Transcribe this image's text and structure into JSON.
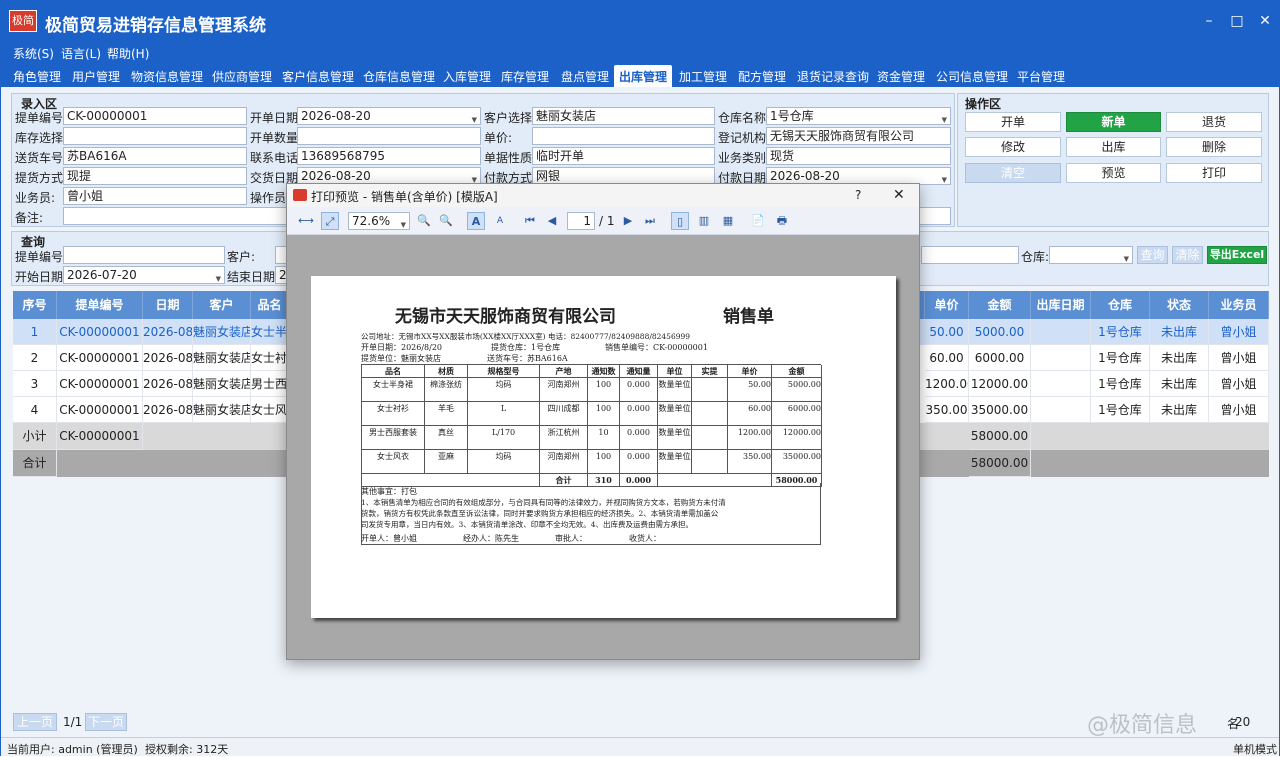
{
  "app": {
    "logo_text": "极简",
    "title": "极简贸易进销存信息管理系统",
    "window_controls": [
      "–",
      "□",
      "✕"
    ]
  },
  "menu": [
    "系统(S)",
    "语言(L)",
    "帮助(H)"
  ],
  "tabs": [
    "角色管理",
    "用户管理",
    "物资信息管理",
    "供应商管理",
    "客户信息管理",
    "仓库信息管理",
    "入库管理",
    "库存管理",
    "盘点管理",
    "出库管理",
    "加工管理",
    "配方管理",
    "退货记录查询",
    "资金管理",
    "公司信息管理",
    "平台管理"
  ],
  "active_tab": "出库管理",
  "entry": {
    "title": "录入区",
    "tihuo_no_label": "提单编号:",
    "tihuo_no": "CK-00000001",
    "open_date_label": "开单日期:",
    "open_date": "2026-08-20",
    "customer_label": "客户选择:",
    "customer": "魅丽女装店",
    "warehouse_label": "仓库名称:",
    "warehouse": "1号仓库",
    "stock_sel_label": "库存选择:",
    "stock_sel": "",
    "qty_label": "开单数量:",
    "qty": "",
    "price_label": "单价:",
    "price": "",
    "org_label": "登记机构:",
    "org": "无锡天天服饰商贸有限公司",
    "car_label": "送货车号:",
    "car": "苏BA616A",
    "phone_label": "联系电话:",
    "phone": "13689568795",
    "doc_nature_label": "单据性质:",
    "doc_nature": "临时开单",
    "biz_type_label": "业务类别:",
    "biz_type": "现货",
    "pickup_label": "提货方式:",
    "pickup": "现提",
    "deliver_date_label": "交货日期:",
    "deliver_date": "2026-08-20",
    "pay_method_label": "付款方式:",
    "pay_method": "网银",
    "pay_date_label": "付款日期:",
    "pay_date": "2026-08-20",
    "salesman_label": "业务员:",
    "salesman": "曾小姐",
    "operator_label": "操作员:",
    "remark_label": "备注:"
  },
  "ops": {
    "title": "操作区",
    "buttons": [
      "开单",
      "新单",
      "退货",
      "修改",
      "出库",
      "删除",
      "清空",
      "预览",
      "打印"
    ]
  },
  "query": {
    "title": "查询",
    "tihuo_no_label": "提单编号:",
    "customer_label": "客户:",
    "start_date_label": "开始日期:",
    "start_date": "2026-07-20",
    "end_date_label": "结束日期:",
    "end_date": "20",
    "warehouse_label": "仓库:",
    "search": "查询",
    "clear": "清除",
    "export": "导出Excel"
  },
  "grid": {
    "columns": [
      "序号",
      "提单编号",
      "日期",
      "客户",
      "品名",
      "单价",
      "金额",
      "出库日期",
      "仓库",
      "状态",
      "业务员"
    ],
    "rows": [
      {
        "no": "1",
        "id": "CK-00000001",
        "date": "2026-08-...",
        "cust": "魅丽女装店",
        "name": "女士半",
        "price": "50.00",
        "amount": "5000.00",
        "out": "",
        "wh": "1号仓库",
        "status": "未出库",
        "staff": "曾小姐"
      },
      {
        "no": "2",
        "id": "CK-00000001",
        "date": "2026-08-...",
        "cust": "魅丽女装店",
        "name": "女士衬",
        "price": "60.00",
        "amount": "6000.00",
        "out": "",
        "wh": "1号仓库",
        "status": "未出库",
        "staff": "曾小姐"
      },
      {
        "no": "3",
        "id": "CK-00000001",
        "date": "2026-08-...",
        "cust": "魅丽女装店",
        "name": "男士西",
        "price": "1200.00",
        "amount": "12000.00",
        "out": "",
        "wh": "1号仓库",
        "status": "未出库",
        "staff": "曾小姐"
      },
      {
        "no": "4",
        "id": "CK-00000001",
        "date": "2026-08-...",
        "cust": "魅丽女装店",
        "name": "女士风",
        "price": "350.00",
        "amount": "35000.00",
        "out": "",
        "wh": "1号仓库",
        "status": "未出库",
        "staff": "曾小姐"
      }
    ],
    "subtotal_label": "小计",
    "subtotal_id": "CK-00000001",
    "subtotal_amount": "58000.00",
    "total_label": "合计",
    "total_amount": "58000.00"
  },
  "pager": {
    "prev": "上一页",
    "page": "1/1",
    "next": "下一页",
    "right_text": "名",
    "right_num": "20"
  },
  "status": {
    "user": "当前用户: admin (管理员)",
    "license": "授权剩余: 312天",
    "mode": "单机模式"
  },
  "watermark": "@极简信息",
  "dialog": {
    "title": "打印预览 - 销售单(含单价) [模版A]",
    "help": "?",
    "close": "✕",
    "zoom": "72.6%",
    "page_cur": "1",
    "page_total": "/ 1"
  },
  "receipt": {
    "company": "无锡市天天服饰商贸有限公司",
    "doc_title": "销售单",
    "address_line": "公司地址：无锡市XX号XX服装市场(XX楼XX厅XXX室) 电话：82400777/82409888/82456999",
    "open_date": "开单日期：2026/8/20",
    "warehouse": "提货仓库：1号仓库",
    "sale_no": "销售单编号：CK-00000001",
    "pickup_unit": "提货单位：魅丽女装店",
    "car": "送货车号：苏BA616A",
    "headers": [
      "品名",
      "材质",
      "规格型号",
      "产地",
      "通知数",
      "通知量",
      "单位",
      "实提",
      "单价",
      "金额"
    ],
    "rows": [
      [
        "女士半身裙",
        "棉涤张纺",
        "均码",
        "河南郑州",
        "100",
        "0.000",
        "数量单位",
        "",
        "50.00",
        "5000.00"
      ],
      [
        "女士衬衫",
        "羊毛",
        "L",
        "四川成都",
        "100",
        "0.000",
        "数量单位",
        "",
        "60.00",
        "6000.00"
      ],
      [
        "男士西服套装",
        "真丝",
        "L/170",
        "浙江杭州",
        "10",
        "0.000",
        "数量单位",
        "",
        "1200.00",
        "12000.00"
      ],
      [
        "女士风衣",
        "亚麻",
        "均码",
        "河南郑州",
        "100",
        "0.000",
        "数量单位",
        "",
        "350.00",
        "35000.00"
      ]
    ],
    "sum_label": "合计",
    "sum_qty": "310",
    "sum_amt": "0.000",
    "sum_total": "58000.00",
    "other": "其他事宜：打包",
    "terms1": "1、本销售清单为相应合同的有效组成部分，与合同具有同等的法律效力，并视同购货方文本，若购货方未付清",
    "terms2": "货款，销货方有权凭此条款直至诉讼法律，同时并要求购货方承担相应的经济损失。2、本销货清单需加盖公",
    "terms3": "司发货专用章，当日内有效。3、本销货清单涂改、印章不全均无效。4、出库费及运费由需方承担。",
    "sign_open": "开单人：曾小姐",
    "sign_handler": "经办人：陈先生",
    "sign_audit": "审批人：",
    "sign_receive": "收货人："
  }
}
